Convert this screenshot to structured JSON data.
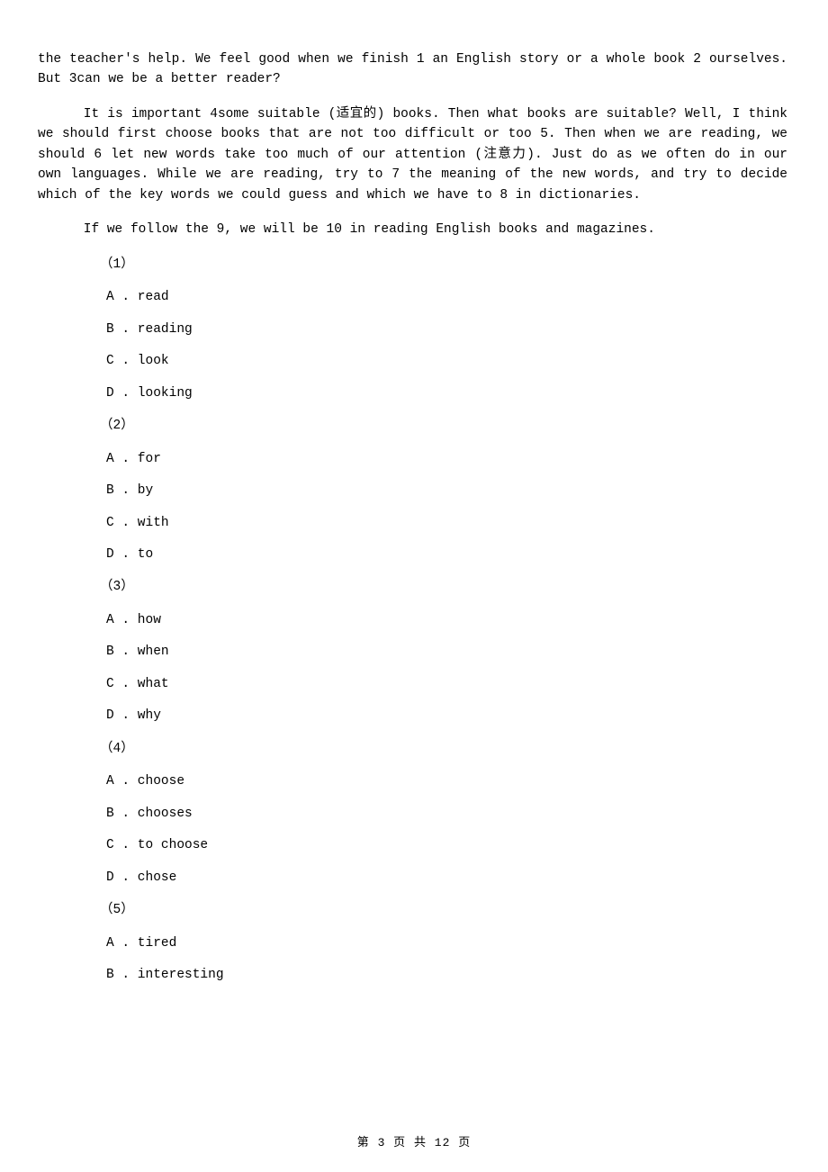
{
  "paragraphs": {
    "p1": "the teacher's help. We feel good when we finish 1  an English story or a whole book 2  ourselves. But 3can we be a better reader?",
    "p2": "It is important 4some suitable (适宜的) books. Then what books are suitable? Well, I think we should first choose books that are not too difficult or too 5. Then when we are reading, we should 6  let new words take too much of our attention (注意力). Just do as we often do in our own languages. While we are reading, try to 7  the meaning of the new words, and try to decide which of the key words we could guess and which we have to 8  in dictionaries.",
    "p3": "If we follow the 9, we will be 10  in reading English books and magazines."
  },
  "questions": [
    {
      "num": "（1）",
      "opts": {
        "A": "A . read",
        "B": "B . reading",
        "C": "C . look",
        "D": "D . looking"
      }
    },
    {
      "num": "（2）",
      "opts": {
        "A": "A . for",
        "B": "B . by",
        "C": "C . with",
        "D": "D . to"
      }
    },
    {
      "num": "（3）",
      "opts": {
        "A": "A . how",
        "B": "B . when",
        "C": "C . what",
        "D": "D . why"
      }
    },
    {
      "num": "（4）",
      "opts": {
        "A": "A . choose",
        "B": "B . chooses",
        "C": "C . to choose",
        "D": "D . chose"
      }
    },
    {
      "num": "（5）",
      "opts": {
        "A": "A . tired",
        "B": "B . interesting"
      }
    }
  ],
  "footer": "第 3 页 共 12 页"
}
